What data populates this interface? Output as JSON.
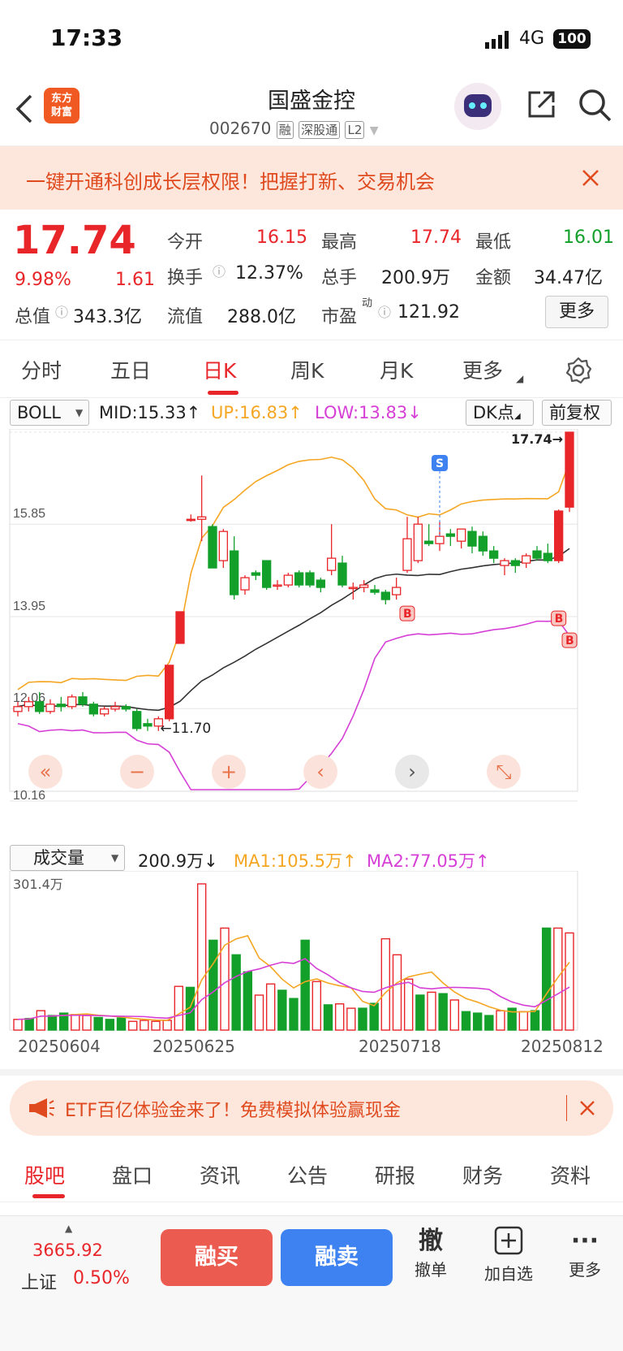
{
  "status_bar": {
    "time": "17:33",
    "network": "4G",
    "battery": "100"
  },
  "header": {
    "title": "国盛金控",
    "code": "002670",
    "tags": [
      "融",
      "深股通",
      "L2"
    ],
    "brand_logo": "东方财富"
  },
  "promo_banner": {
    "text": "一键开通科创成长层权限！把握打新、交易机会"
  },
  "quote": {
    "price": "17.74",
    "change_pct": "9.98%",
    "change": "1.61",
    "total_value_label": "总值",
    "total_value": "343.3亿",
    "fields": [
      {
        "label": "今开",
        "value": "16.15"
      },
      {
        "label": "最高",
        "value": "17.74"
      },
      {
        "label": "最低",
        "value": "16.01"
      },
      {
        "label": "换手",
        "value": "12.37%"
      },
      {
        "label": "总手",
        "value": "200.9万"
      },
      {
        "label": "金额",
        "value": "34.47亿"
      },
      {
        "label": "流值",
        "value": "288.0亿"
      },
      {
        "label": "市盈",
        "sup": "动",
        "value": "121.92"
      }
    ],
    "more_button": "更多"
  },
  "period_tabs": [
    {
      "label": "分时",
      "active": false
    },
    {
      "label": "五日",
      "active": false
    },
    {
      "label": "日K",
      "active": true
    },
    {
      "label": "周K",
      "active": false
    },
    {
      "label": "月K",
      "active": false
    },
    {
      "label": "更多",
      "active": false
    }
  ],
  "indicator_bar": {
    "indicator": "BOLL",
    "mid": "MID:15.33↑",
    "up": "UP:16.83↑",
    "low": "LOW:13.83↓",
    "dk_button": "DK点",
    "adjust_button": "前复权"
  },
  "chart_data": {
    "type": "candlestick",
    "y_ticks": [
      "17.74",
      "15.85",
      "13.95",
      "12.06",
      "10.16"
    ],
    "ylim": [
      10.16,
      17.74
    ],
    "annotations": {
      "high_marker": "17.74",
      "low_marker": "11.70",
      "sell_marker": "S",
      "buy_marker": "B"
    },
    "colors": {
      "up": "#e8262a",
      "down": "#12a02a",
      "boll_up": "#f5a623",
      "boll_mid": "#333333",
      "boll_low": "#d63fd6"
    },
    "candles": [
      {
        "o": 12.0,
        "h": 12.2,
        "l": 11.9,
        "c": 12.1
      },
      {
        "o": 12.1,
        "h": 12.3,
        "l": 12.0,
        "c": 12.2
      },
      {
        "o": 12.2,
        "h": 12.4,
        "l": 11.95,
        "c": 12.0
      },
      {
        "o": 12.0,
        "h": 12.25,
        "l": 11.95,
        "c": 12.15
      },
      {
        "o": 12.15,
        "h": 12.3,
        "l": 12.0,
        "c": 12.1
      },
      {
        "o": 12.1,
        "h": 12.35,
        "l": 12.05,
        "c": 12.3
      },
      {
        "o": 12.3,
        "h": 12.4,
        "l": 12.1,
        "c": 12.15
      },
      {
        "o": 12.15,
        "h": 12.2,
        "l": 11.9,
        "c": 11.95
      },
      {
        "o": 11.95,
        "h": 12.1,
        "l": 11.9,
        "c": 12.05
      },
      {
        "o": 12.05,
        "h": 12.2,
        "l": 12.0,
        "c": 12.1
      },
      {
        "o": 12.1,
        "h": 12.15,
        "l": 12.0,
        "c": 12.05
      },
      {
        "o": 12.0,
        "h": 12.05,
        "l": 11.6,
        "c": 11.65
      },
      {
        "o": 11.75,
        "h": 11.85,
        "l": 11.6,
        "c": 11.7
      },
      {
        "o": 11.7,
        "h": 11.9,
        "l": 11.6,
        "c": 11.85
      },
      {
        "o": 11.85,
        "h": 12.95,
        "l": 11.8,
        "c": 12.95
      },
      {
        "o": 13.4,
        "h": 14.05,
        "l": 13.4,
        "c": 14.05
      },
      {
        "o": 15.95,
        "h": 16.05,
        "l": 15.9,
        "c": 15.95
      },
      {
        "o": 15.95,
        "h": 16.85,
        "l": 15.5,
        "c": 16.0
      },
      {
        "o": 15.8,
        "h": 15.85,
        "l": 14.95,
        "c": 14.95
      },
      {
        "o": 15.1,
        "h": 15.75,
        "l": 14.95,
        "c": 15.7
      },
      {
        "o": 15.3,
        "h": 15.6,
        "l": 14.3,
        "c": 14.4
      },
      {
        "o": 14.5,
        "h": 14.8,
        "l": 14.4,
        "c": 14.75
      },
      {
        "o": 14.85,
        "h": 14.9,
        "l": 14.7,
        "c": 14.8
      },
      {
        "o": 15.1,
        "h": 15.1,
        "l": 14.5,
        "c": 14.55
      },
      {
        "o": 14.6,
        "h": 14.7,
        "l": 14.5,
        "c": 14.6
      },
      {
        "o": 14.6,
        "h": 14.85,
        "l": 14.55,
        "c": 14.8
      },
      {
        "o": 14.85,
        "h": 14.9,
        "l": 14.55,
        "c": 14.6
      },
      {
        "o": 14.85,
        "h": 14.9,
        "l": 14.55,
        "c": 14.6
      },
      {
        "o": 14.7,
        "h": 14.75,
        "l": 14.45,
        "c": 14.55
      },
      {
        "o": 14.9,
        "h": 15.85,
        "l": 14.8,
        "c": 15.15
      },
      {
        "o": 15.05,
        "h": 15.2,
        "l": 14.55,
        "c": 14.6
      },
      {
        "o": 14.55,
        "h": 14.65,
        "l": 14.3,
        "c": 14.55
      },
      {
        "o": 14.55,
        "h": 14.7,
        "l": 14.45,
        "c": 14.6
      },
      {
        "o": 14.5,
        "h": 14.6,
        "l": 14.4,
        "c": 14.45
      },
      {
        "o": 14.45,
        "h": 14.5,
        "l": 14.2,
        "c": 14.3
      },
      {
        "o": 14.4,
        "h": 14.75,
        "l": 14.3,
        "c": 14.55
      },
      {
        "o": 14.9,
        "h": 16.0,
        "l": 14.85,
        "c": 15.55
      },
      {
        "o": 15.1,
        "h": 16.0,
        "l": 15.05,
        "c": 15.85
      },
      {
        "o": 15.5,
        "h": 15.85,
        "l": 15.4,
        "c": 15.45
      },
      {
        "o": 15.45,
        "h": 15.9,
        "l": 15.3,
        "c": 15.6
      },
      {
        "o": 15.65,
        "h": 15.75,
        "l": 15.4,
        "c": 15.6
      },
      {
        "o": 15.5,
        "h": 15.75,
        "l": 15.35,
        "c": 15.75
      },
      {
        "o": 15.7,
        "h": 15.8,
        "l": 15.25,
        "c": 15.4
      },
      {
        "o": 15.6,
        "h": 15.7,
        "l": 15.2,
        "c": 15.3
      },
      {
        "o": 15.3,
        "h": 15.4,
        "l": 15.05,
        "c": 15.15
      },
      {
        "o": 15.0,
        "h": 15.15,
        "l": 14.8,
        "c": 15.1
      },
      {
        "o": 15.1,
        "h": 15.15,
        "l": 14.85,
        "c": 15.0
      },
      {
        "o": 15.05,
        "h": 15.25,
        "l": 14.95,
        "c": 15.2
      },
      {
        "o": 15.3,
        "h": 15.4,
        "l": 15.1,
        "c": 15.15
      },
      {
        "o": 15.25,
        "h": 15.45,
        "l": 15.05,
        "c": 15.1
      },
      {
        "o": 15.1,
        "h": 16.15,
        "l": 15.05,
        "c": 16.12
      },
      {
        "o": 16.2,
        "h": 17.74,
        "l": 16.1,
        "c": 17.74
      }
    ],
    "volume": {
      "label": "成交量",
      "value": "200.9万↓",
      "ma1": "MA1:105.5万↑",
      "ma2": "MA2:77.05万↑",
      "ymax_label": "301.4万",
      "values": [
        22,
        24,
        40,
        30,
        35,
        32,
        30,
        26,
        22,
        25,
        18,
        20,
        18,
        20,
        90,
        88,
        301,
        185,
        210,
        155,
        120,
        72,
        95,
        82,
        65,
        185,
        100,
        52,
        54,
        45,
        45,
        55,
        188,
        155,
        105,
        72,
        78,
        75,
        62,
        38,
        35,
        30,
        40,
        45,
        38,
        40,
        210,
        210,
        200
      ]
    },
    "x_labels": [
      "20250604",
      "20250625",
      "20250718",
      "20250812"
    ]
  },
  "chart_controls": [
    "«",
    "−",
    "+",
    "‹",
    "›",
    "⤡"
  ],
  "etf_banner": {
    "text": "ETF百亿体验金来了！免费模拟体验赢现金"
  },
  "section_tabs": [
    {
      "label": "股吧",
      "active": true
    },
    {
      "label": "盘口",
      "active": false
    },
    {
      "label": "资讯",
      "active": false
    },
    {
      "label": "公告",
      "active": false
    },
    {
      "label": "研报",
      "active": false
    },
    {
      "label": "财务",
      "active": false
    },
    {
      "label": "资料",
      "active": false
    }
  ],
  "footer": {
    "index_value": "3665.92",
    "index_name": "上证",
    "index_change": "0.50%",
    "buy": "融买",
    "sell": "融卖",
    "cancel_icon": "撤",
    "cancel": "撤单",
    "add": "加自选",
    "more": "更多"
  }
}
